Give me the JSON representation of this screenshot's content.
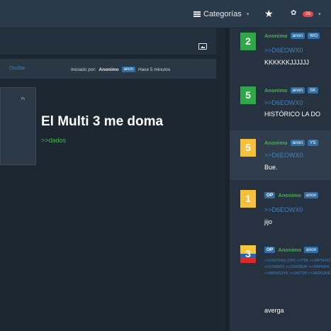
{
  "topbar": {
    "categories_label": "Categorías",
    "caret": "▾",
    "star": "★",
    "mascot": "✿",
    "notif_count": "26"
  },
  "thread": {
    "hide_label": "Ocultar",
    "started_by_label": "Iniciado por:",
    "author": "Anonimo",
    "author_badge": "anon",
    "time_ago": "Hace 5 minutos",
    "card_timestamp": "7h",
    "title": "El Multi 3 me doma",
    "link": ">>dados"
  },
  "replies": [
    {
      "number": "2",
      "color": "#2fa84a",
      "op": "",
      "name": "Anonimo",
      "badge": "anon",
      "tag": "WG",
      "quote": ">>D6EOWX0",
      "text": "KKKKKKJJJJJJ"
    },
    {
      "number": "5",
      "color": "#2fa84a",
      "op": "",
      "name": "Anonimo",
      "badge": "anon",
      "tag": "SK",
      "quote": ">>D6EOWX0",
      "text": "HISTÓRICO LA DO"
    },
    {
      "number": "5",
      "color": "#f5c13a",
      "op": "",
      "name": "Anonimo",
      "badge": "anon",
      "tag": "YS",
      "quote": ">>D6EOWX0",
      "text": "Bue."
    },
    {
      "number": "1",
      "color": "#f5c13a",
      "op": "OP",
      "name": "Anonimo",
      "badge": "anon",
      "tag": "",
      "quote": ">>D6EOWX0",
      "text": "jijo"
    },
    {
      "number": "3",
      "color": "flag",
      "op": "OP",
      "name": "Anonimo",
      "badge": "anon",
      "tag": "",
      "quote": ">>U3076XQ (OP) >>Y5K >>39P5H9Z >>OS8ND0 >>O5KBB4F >>XRPM54 >>M8WG3YK >>JWT2B >>3AD5QNE",
      "text": "averga"
    }
  ]
}
